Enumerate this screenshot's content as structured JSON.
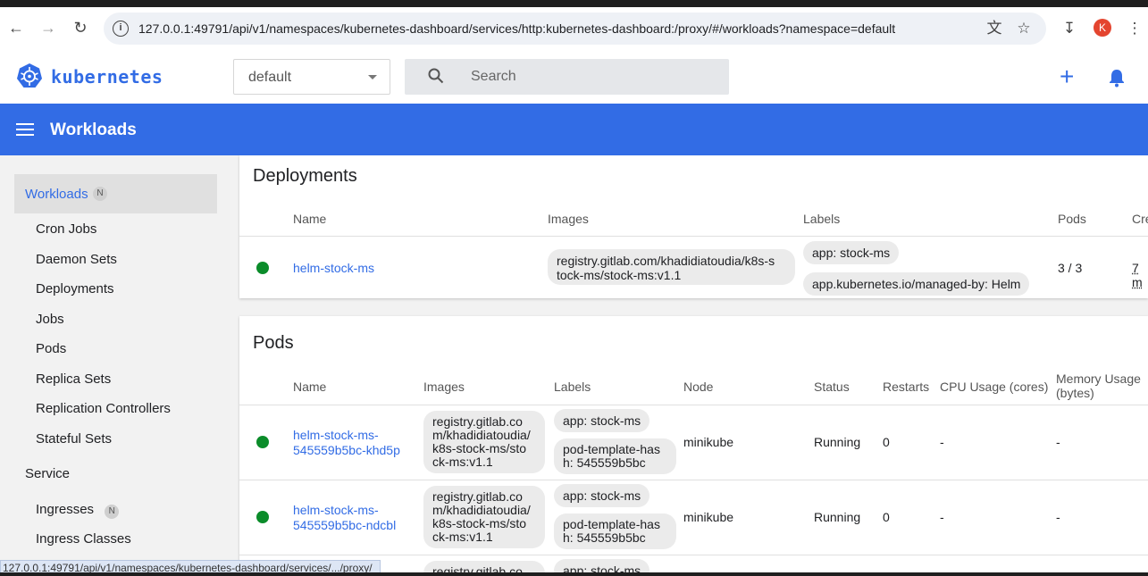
{
  "browser": {
    "url": "127.0.0.1:49791/api/v1/namespaces/kubernetes-dashboard/services/http:kubernetes-dashboard:/proxy/#/workloads?namespace=default",
    "avatar_letter": "K",
    "status_url": "127.0.0.1:49791/api/v1/namespaces/kubernetes-dashboard/services/.../proxy/"
  },
  "header": {
    "brand": "kubernetes",
    "namespace": "default",
    "search_placeholder": "Search"
  },
  "toolbar": {
    "title": "Workloads"
  },
  "sidebar": {
    "active": {
      "label": "Workloads",
      "badge": "N"
    },
    "items": [
      "Cron Jobs",
      "Daemon Sets",
      "Deployments",
      "Jobs",
      "Pods",
      "Replica Sets",
      "Replication Controllers",
      "Stateful Sets"
    ],
    "section": "Service",
    "service_items": [
      {
        "label": "Ingresses",
        "badge": "N"
      },
      {
        "label": "Ingress Classes"
      }
    ]
  },
  "deployments": {
    "title": "Deployments",
    "columns": [
      "Name",
      "Images",
      "Labels",
      "Pods",
      "Cre"
    ],
    "rows": [
      {
        "name": "helm-stock-ms",
        "image": "registry.gitlab.com/khadidiatoudia/k8s-stock-ms/stock-ms:v1.1",
        "image_line1": "registry.gitlab.com/khadidiatoudia/k8s-s",
        "image_line2": "tock-ms/stock-ms:v1.1",
        "labels": [
          "app: stock-ms",
          "app.kubernetes.io/managed-by: Helm"
        ],
        "pods": "3 / 3",
        "created": "7 m"
      }
    ]
  },
  "pods": {
    "title": "Pods",
    "columns": [
      "Name",
      "Images",
      "Labels",
      "Node",
      "Status",
      "Restarts",
      "CPU Usage (cores)",
      "Memory Usage",
      "(bytes)"
    ],
    "rows": [
      {
        "name_line1": "helm-stock-ms-",
        "name_line2": "545559b5bc-khd5p",
        "image_lines": [
          "registry.gitlab.co",
          "m/khadidiatoudia/",
          "k8s-stock-ms/sto",
          "ck-ms:v1.1"
        ],
        "label1": "app: stock-ms",
        "label2_line1": "pod-template-has",
        "label2_line2": "h: 545559b5bc",
        "node": "minikube",
        "status": "Running",
        "restarts": "0",
        "cpu": "-",
        "memory": "-"
      },
      {
        "name_line1": "helm-stock-ms-",
        "name_line2": "545559b5bc-ndcbl",
        "image_lines": [
          "registry.gitlab.co",
          "m/khadidiatoudia/",
          "k8s-stock-ms/sto",
          "ck-ms:v1.1"
        ],
        "label1": "app: stock-ms",
        "label2_line1": "pod-template-has",
        "label2_line2": "h: 545559b5bc",
        "node": "minikube",
        "status": "Running",
        "restarts": "0",
        "cpu": "-",
        "memory": "-"
      },
      {
        "image_partial": "registry.gitlab.co",
        "label_partial": "app: stock-ms"
      }
    ]
  },
  "colors": {
    "brand": "#326ce5",
    "running": "#0b8c2a",
    "toolbar": "#326ce5"
  }
}
